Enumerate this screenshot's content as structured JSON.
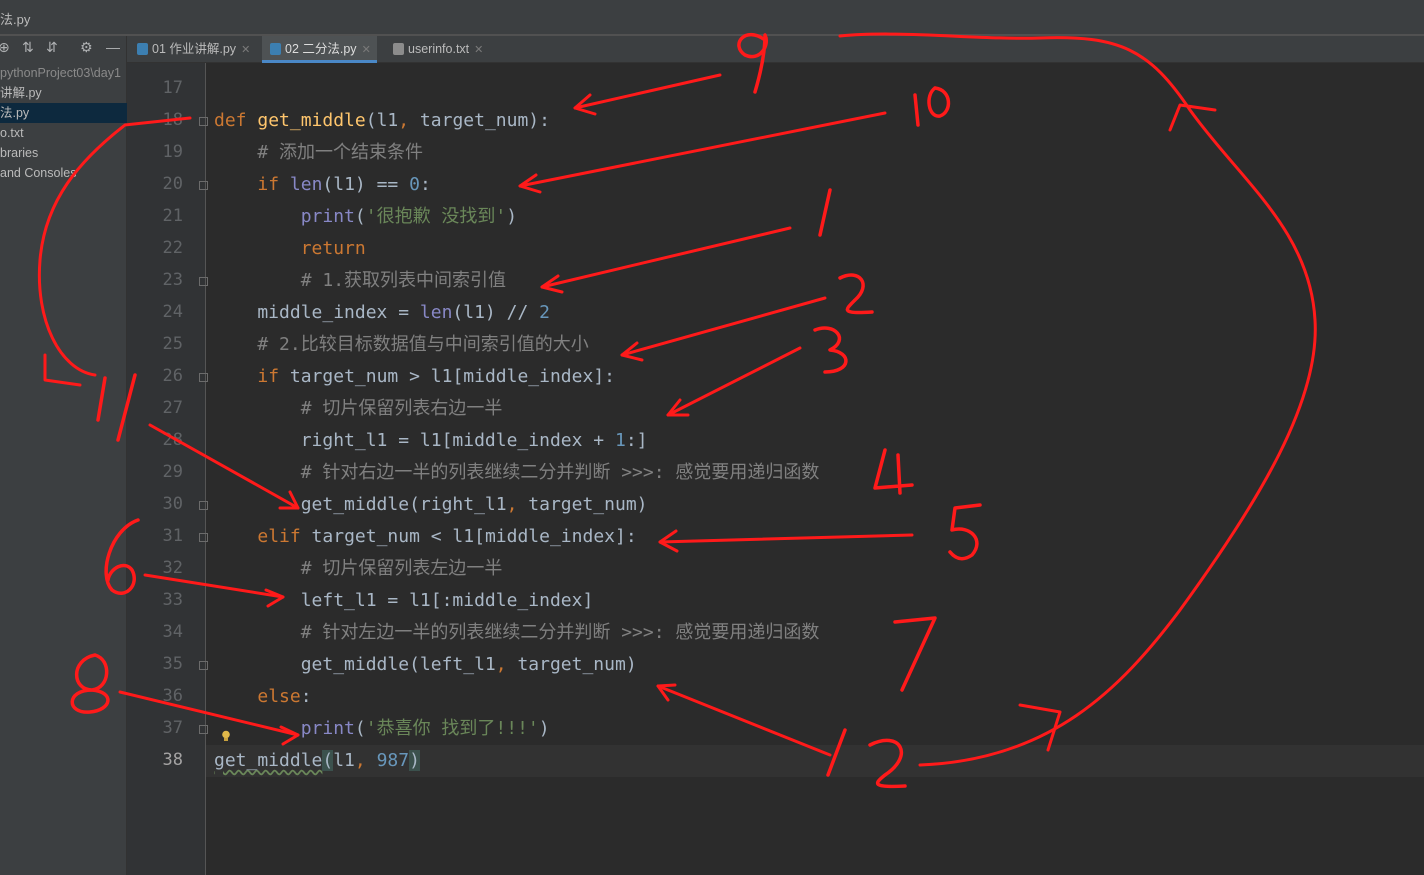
{
  "window": {
    "title": "法.py"
  },
  "sidebar": {
    "items": [
      {
        "label": "pythonProject03\\day1",
        "dim": true
      },
      {
        "label": "讲解.py"
      },
      {
        "label": "法.py",
        "selected": true
      },
      {
        "label": "o.txt"
      },
      {
        "label": "braries"
      },
      {
        "label": "and Consoles"
      }
    ]
  },
  "tabs": [
    {
      "label": "01 作业讲解.py",
      "active": false
    },
    {
      "label": "02 二分法.py",
      "active": true
    },
    {
      "label": "userinfo.txt",
      "active": false
    }
  ],
  "editor": {
    "line_numbers": [
      "17",
      "18",
      "19",
      "20",
      "21",
      "22",
      "23",
      "24",
      "25",
      "26",
      "27",
      "28",
      "29",
      "30",
      "31",
      "32",
      "33",
      "34",
      "35",
      "36",
      "37",
      "38"
    ],
    "current_line": "38",
    "lines": [
      "",
      "def get_middle(l1, target_num):",
      "    # 添加一个结束条件",
      "    if len(l1) == 0:",
      "        print('很抱歉 没找到')",
      "        return",
      "        # 1.获取列表中间索引值",
      "    middle_index = len(l1) // 2",
      "    # 2.比较目标数据值与中间索引值的大小",
      "    if target_num > l1[middle_index]:",
      "        # 切片保留列表右边一半",
      "        right_l1 = l1[middle_index + 1:]",
      "        # 针对右边一半的列表继续二分并判断 >>>: 感觉要用递归函数",
      "        get_middle(right_l1, target_num)",
      "    elif target_num < l1[middle_index]:",
      "        # 切片保留列表左边一半",
      "        left_l1 = l1[:middle_index]",
      "        # 针对左边一半的列表继续二分并判断 >>>: 感觉要用递归函数",
      "        get_middle(left_l1, target_num)",
      "    else:",
      "        print('恭喜你 找到了!!!')",
      "get_middle(l1, 987)"
    ]
  },
  "annotations": {
    "color": "#ff1a1a",
    "labels": [
      "9",
      "10",
      "1",
      "2",
      "3",
      "4",
      "5",
      "11",
      "6",
      "7",
      "8",
      "12"
    ]
  }
}
